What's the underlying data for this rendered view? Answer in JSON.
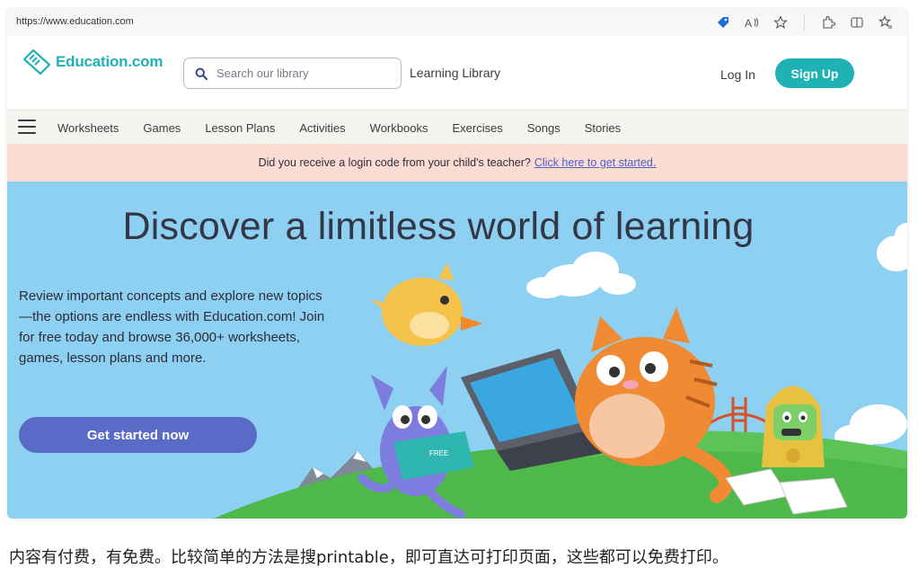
{
  "browser": {
    "url": "https://www.education.com"
  },
  "header": {
    "logo_text": "Education.com",
    "search_placeholder": "Search our library",
    "library_link": "Learning Library",
    "login_label": "Log In",
    "signup_label": "Sign Up"
  },
  "nav": {
    "items": [
      {
        "label": "Worksheets"
      },
      {
        "label": "Games"
      },
      {
        "label": "Lesson Plans"
      },
      {
        "label": "Activities"
      },
      {
        "label": "Workbooks"
      },
      {
        "label": "Exercises"
      },
      {
        "label": "Songs"
      },
      {
        "label": "Stories"
      }
    ]
  },
  "banner": {
    "text": "Did you receive a login code from your child's teacher?",
    "link": "Click here to get started."
  },
  "hero": {
    "title": "Discover a limitless world of learning",
    "body": "Review important concepts and explore new topics—the options are endless with Education.com! Join for free today and browse 36,000+ worksheets, games, lesson plans and more.",
    "cta_label": "Get started now",
    "book_cover_text": "FREE"
  },
  "caption": {
    "text": "内容有付费，有免费。比较简单的方法是搜printable，即可直达可打印页面，这些都可以免费打印。"
  },
  "colors": {
    "brand_teal": "#1fb2b5",
    "hero_sky": "#8dd0f1",
    "banner_bg": "#fbdcd2",
    "cta_purple": "#5a6ac7",
    "grass": "#4fb84a"
  },
  "icons": {
    "browser_toolbar": [
      "shield-tag-icon",
      "read-aloud-icon",
      "favorite-star-icon",
      "extensions-icon",
      "split-screen-icon",
      "favorites-list-icon"
    ],
    "search": "search-icon",
    "menu": "hamburger-menu-icon"
  }
}
